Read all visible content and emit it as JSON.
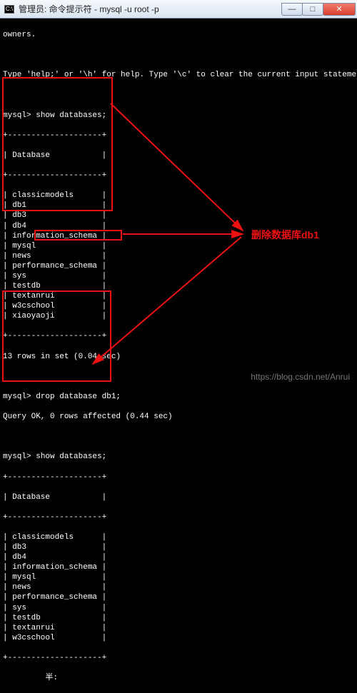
{
  "window": {
    "win_icon_label": "C:\\",
    "title": "管理员: 命令提示符 - mysql  -u root -p",
    "min": "—",
    "max": "□",
    "close": "✕"
  },
  "term": {
    "owners_line": "owners.",
    "help_line": "Type 'help;' or '\\h' for help. Type '\\c' to clear the current input statement.",
    "prompt": "mysql>",
    "cmd_show1": "show databases;",
    "sep": "+--------------------+",
    "col_header": "| Database           |",
    "list1": {
      "items": [
        "| classicmodels      |",
        "| db1                |",
        "| db3                |",
        "| db4                |",
        "| information_schema |",
        "| mysql              |",
        "| news               |",
        "| performance_schema |",
        "| sys                |",
        "| testdb             |",
        "| textanrui          |",
        "| w3cschool          |",
        "| xiaoyaoji          |"
      ]
    },
    "rows1": "13 rows in set (0.04 sec)",
    "cmd_drop": "drop database db1;",
    "drop_result": "Query OK, 0 rows affected (0.44 sec)",
    "cmd_show2": "show databases;",
    "list2": {
      "items": [
        "| classicmodels      |",
        "| db3                |",
        "| db4                |",
        "| information_schema |",
        "| mysql              |",
        "| news               |",
        "| performance_schema |",
        "| sys                |",
        "| testdb             |",
        "| textanrui          |",
        "| w3cschool          |"
      ]
    },
    "footer_glyph": "半:"
  },
  "annotation": {
    "label": "删除数据库db1"
  },
  "watermark": "https://blog.csdn.net/Anrui"
}
